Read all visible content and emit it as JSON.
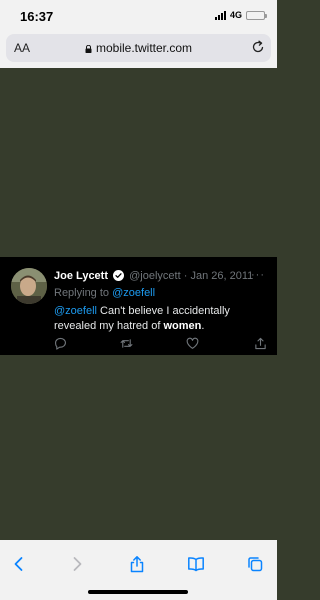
{
  "status": {
    "time": "16:37",
    "network": "4G"
  },
  "browser": {
    "text_size_label": "AA",
    "url": "mobile.twitter.com"
  },
  "tweet": {
    "name": "Joe Lycett",
    "handle": "@joelycett",
    "separator": "·",
    "date": "Jan 26, 2011",
    "more": "···",
    "replying_prefix": "Replying to",
    "replying_to": "@zoefell",
    "mention": "@zoefell",
    "text_part1": "Can't believe I accidentally revealed my hatred of",
    "text_bold": "women",
    "text_end": "."
  },
  "icons": [
    "signal-icon",
    "battery-icon",
    "lock-icon",
    "reload-icon",
    "verified-icon",
    "reply-icon",
    "retweet-icon",
    "like-icon",
    "share-icon",
    "back-icon",
    "forward-icon",
    "share-sheet-icon",
    "bookmarks-icon",
    "tabs-icon"
  ],
  "colors": {
    "page_bg": "#363c2c",
    "tweet_bg": "#000000",
    "link": "#1d9bf0",
    "safari_blue": "#0a84ff"
  }
}
